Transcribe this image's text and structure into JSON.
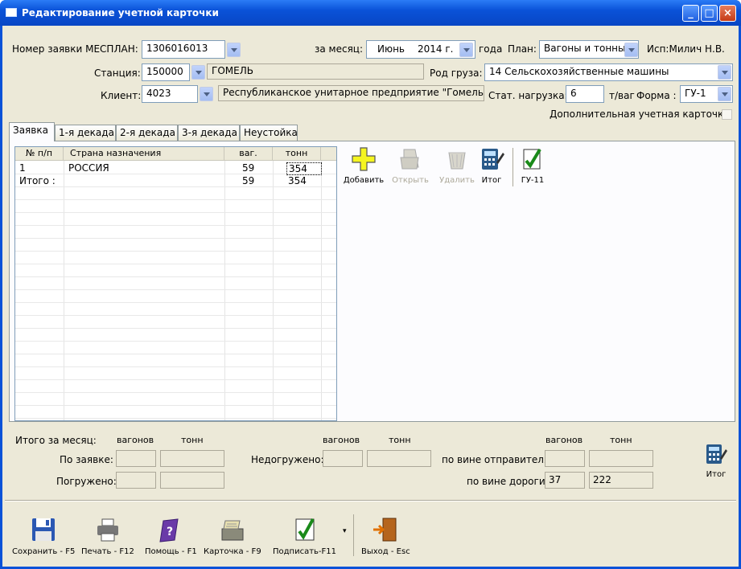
{
  "window": {
    "title": "Редактирование учетной карточки"
  },
  "form": {
    "mesplan_label": "Номер заявки МЕСПЛАН:",
    "mesplan_value": "1306016013",
    "month_label": "за месяц:",
    "month_value": "Июнь",
    "year_value": "2014 г.",
    "year_label": "года",
    "plan_label": "План:",
    "plan_value": "Вагоны и тонны",
    "executor": "Исп:Милич Н.В.",
    "station_label": "Станция:",
    "station_code": "150000",
    "station_name": "ГОМЕЛЬ",
    "cargo_label": "Род груза:",
    "cargo_value": "14 Сельскохозяйственные машины",
    "client_label": "Клиент:",
    "client_code": "4023",
    "client_name": "Республиканское унитарное предприятие \"Гомельски",
    "load_label": "Стат. нагрузка:",
    "load_value": "6",
    "load_unit": "т/ваг",
    "form_label": "Форма :",
    "form_value": "ГУ-1",
    "extra_card_label": "Дополнительная учетная карточка"
  },
  "tabs": [
    "Заявка",
    "1-я декада",
    "2-я декада",
    "3-я декада",
    "Неустойка"
  ],
  "grid": {
    "columns": [
      "№ п/п",
      "Страна назначения",
      "ваг.",
      "тонн"
    ],
    "rows": [
      {
        "n": "1",
        "country": "РОССИЯ",
        "wag": "59",
        "ton": "354"
      },
      {
        "n": "Итого :",
        "country": "",
        "wag": "59",
        "ton": "354"
      }
    ]
  },
  "tools": {
    "add": "Добавить",
    "open": "Открыть",
    "delete": "Удалить",
    "total": "Итог",
    "gu11": "ГУ-11"
  },
  "summary": {
    "month_total": "Итого за месяц:",
    "wagons": "вагонов",
    "tons": "тонн",
    "by_request": "По заявке:",
    "loaded": "Погружено:",
    "underloaded": "Недогружено:",
    "sender_fault": "по вине отправителя",
    "road_fault": "по вине дороги",
    "road_wagons": "37",
    "road_tons": "222",
    "total_button": "Итог"
  },
  "footer": {
    "save": "Сохранить - F5",
    "print": "Печать - F12",
    "help": "Помощь - F1",
    "card": "Карточка - F9",
    "sign": "Подписать-F11",
    "exit": "Выход - Esc"
  }
}
